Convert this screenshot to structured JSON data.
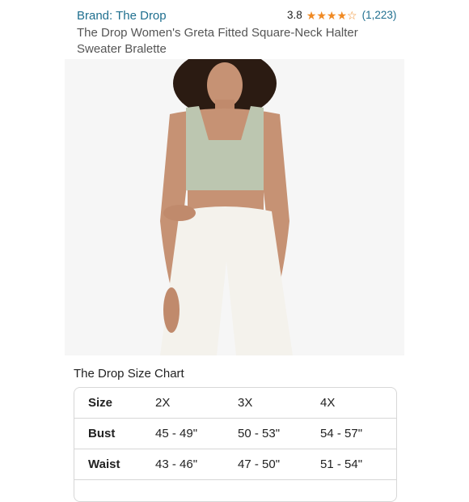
{
  "product": {
    "brand": "Brand: The Drop",
    "rating_value": "3.8",
    "rating_fraction": 0.76,
    "rating_count": "(1,223)",
    "title": "The Drop Women's Greta Fitted Square-Neck Halter Sweater Bralette"
  },
  "size_chart": {
    "heading": "The Drop Size Chart",
    "rows": [
      {
        "label": "Size",
        "values": [
          "2X",
          "3X",
          "4X"
        ]
      },
      {
        "label": "Bust",
        "values": [
          "45 - 49\"",
          "50 - 53\"",
          "54 - 57\""
        ]
      },
      {
        "label": "Waist",
        "values": [
          "43 - 46\"",
          "47 - 50\"",
          "51 - 54\""
        ]
      }
    ]
  },
  "colors": {
    "link": "#1f6f8f",
    "star": "#f08a24",
    "top_garment": "#bcc6b0",
    "pants": "#f4f2ec"
  }
}
